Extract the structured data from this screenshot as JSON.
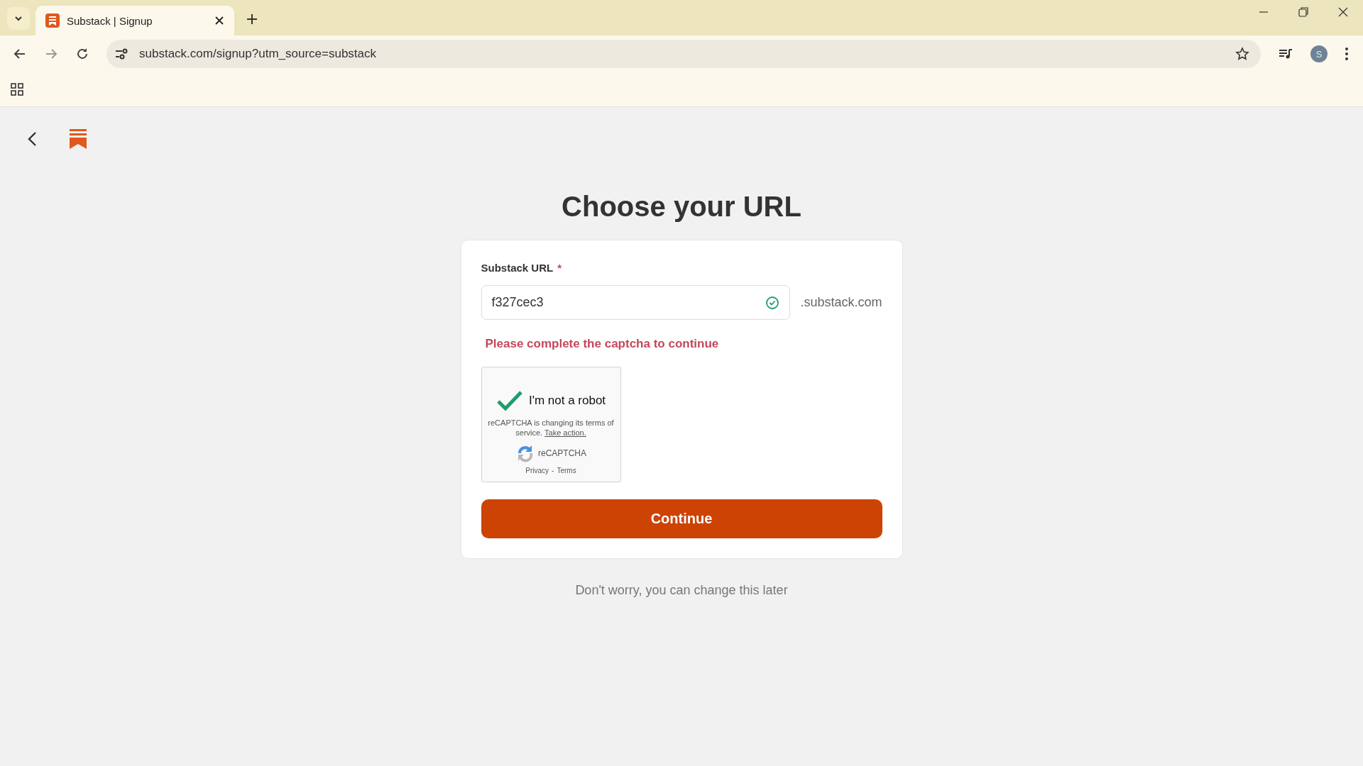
{
  "browser": {
    "tabs": [
      {
        "title": "Substack | Signup",
        "selected": true
      }
    ],
    "address": "substack.com/signup?utm_source=substack",
    "profile_initial": "S"
  },
  "page": {
    "title": "Choose your URL",
    "form": {
      "label": "Substack URL",
      "required_mark": "*",
      "value": "f327cec3",
      "valid": true,
      "suffix": ".substack.com",
      "error": "Please complete the captcha to continue",
      "captcha": {
        "checked": true,
        "label": "I'm not a robot",
        "notice": "reCAPTCHA is changing its terms of service.",
        "notice_link": "Take action.",
        "brand": "reCAPTCHA",
        "privacy": "Privacy",
        "separator": "-",
        "terms": "Terms"
      },
      "button": "Continue"
    },
    "footer": "Don't worry, you can change this later"
  }
}
